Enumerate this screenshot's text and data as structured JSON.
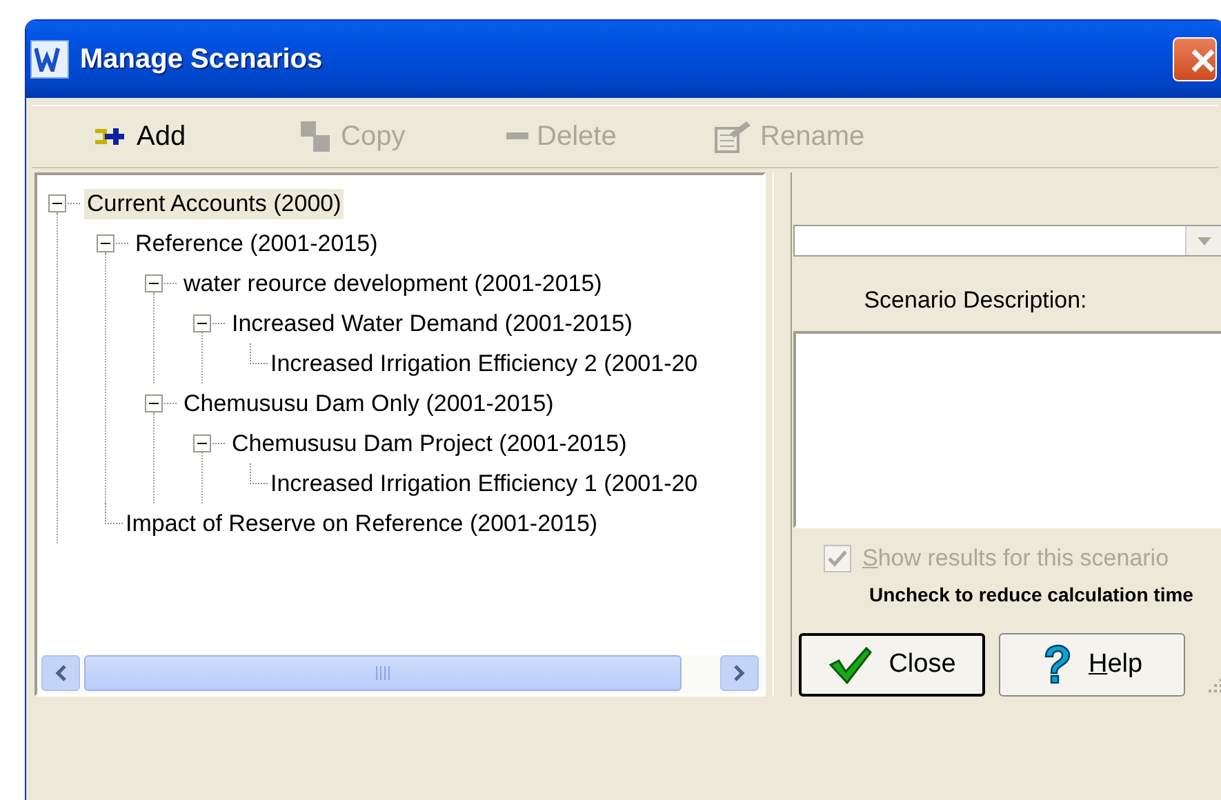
{
  "window": {
    "title": "Manage Scenarios"
  },
  "toolbar": [
    {
      "label": "Add",
      "kind": "add",
      "disabled": false
    },
    {
      "label": "Copy",
      "kind": "copy",
      "disabled": true
    },
    {
      "label": "Delete",
      "kind": "delete",
      "disabled": true
    },
    {
      "label": "Rename",
      "kind": "rename",
      "disabled": true
    }
  ],
  "tree": [
    {
      "label": "Current Accounts (2000)",
      "selected": true,
      "expanded": true,
      "children": [
        {
          "label": "Reference (2001-2015)",
          "selected": false,
          "expanded": true,
          "children": [
            {
              "label": "water reource development (2001-2015)",
              "selected": false,
              "expanded": true,
              "children": [
                {
                  "label": "Increased Water Demand (2001-2015)",
                  "selected": false,
                  "expanded": true,
                  "children": [
                    {
                      "label": "Increased Irrigation Efficiency 2 (2001-20",
                      "selected": false
                    }
                  ]
                }
              ]
            },
            {
              "label": "Chemususu Dam Only (2001-2015)",
              "selected": false,
              "expanded": true,
              "children": [
                {
                  "label": "Chemususu Dam Project (2001-2015)",
                  "selected": false,
                  "expanded": true,
                  "children": [
                    {
                      "label": "Increased Irrigation Efficiency 1 (2001-20",
                      "selected": false
                    }
                  ]
                }
              ]
            }
          ]
        },
        {
          "label": "Impact of Reserve on Reference (2001-2015)",
          "selected": false
        }
      ]
    }
  ],
  "description_label": "Scenario Description:",
  "show_results": {
    "label": "Show results for this scenario",
    "checked": true,
    "disabled": true
  },
  "hint": "Uncheck to reduce calculation time",
  "buttons": [
    {
      "label": "Close",
      "kind": "close"
    },
    {
      "label": "Help",
      "kind": "help"
    }
  ]
}
